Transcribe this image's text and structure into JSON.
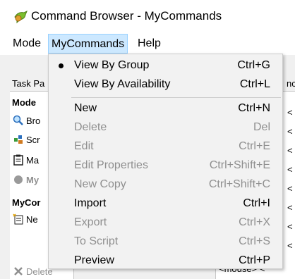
{
  "window": {
    "title": "Command Browser - MyCommands"
  },
  "menubar": {
    "items": [
      "Mode",
      "MyCommands",
      "Help"
    ]
  },
  "left_pane": {
    "header": "Task Pa",
    "mode_section": "Mode",
    "mode_items": [
      "Bro",
      "Scr",
      "Ma",
      "My"
    ],
    "mycommands_section": "MyCor",
    "mycommands_items": [
      "Ne",
      "Delete"
    ]
  },
  "right_list": {
    "header": "nc",
    "rows": [
      "<",
      "<",
      "<",
      "<",
      "<",
      "<",
      "<",
      "<",
      "<"
    ],
    "last_row": "<mouse> <"
  },
  "dropdown": {
    "items": [
      {
        "label": "View By Group",
        "shortcut": "Ctrl+G",
        "checked": true,
        "enabled": true
      },
      {
        "label": "View By Availability",
        "shortcut": "Ctrl+L",
        "checked": false,
        "enabled": true
      },
      {
        "label": "New",
        "shortcut": "Ctrl+N",
        "enabled": true
      },
      {
        "label": "Delete",
        "shortcut": "Del",
        "enabled": false
      },
      {
        "label": "Edit",
        "shortcut": "Ctrl+E",
        "enabled": false
      },
      {
        "label": "Edit Properties",
        "shortcut": "Ctrl+Shift+E",
        "enabled": false
      },
      {
        "label": "New Copy",
        "shortcut": "Ctrl+Shift+C",
        "enabled": false
      },
      {
        "label": "Import",
        "shortcut": "Ctrl+I",
        "enabled": true
      },
      {
        "label": "Export",
        "shortcut": "Ctrl+X",
        "enabled": false
      },
      {
        "label": "To Script",
        "shortcut": "Ctrl+S",
        "enabled": false
      },
      {
        "label": "Preview",
        "shortcut": "Ctrl+P",
        "enabled": true
      }
    ]
  },
  "colors": {
    "menu_active_bg": "#cce8ff",
    "disabled_text": "#8f8f8f"
  }
}
